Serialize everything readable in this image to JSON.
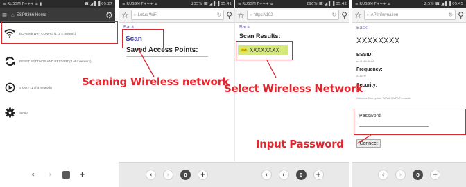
{
  "panel1": {
    "status_left": "≡ RUSSM F+++ ☕ ▮",
    "status_right": "☎ ◢ ▌▐ 05:27",
    "url_title": "ESP8266 Home",
    "menu_items": [
      {
        "icon": "wifi-icon",
        "text": "ECP8266 WIFI CONFIG (1 of 4 network)"
      },
      {
        "icon": "refresh-icon",
        "text": "RESET SETTINGS AND RESTART (3 of 4 network)"
      },
      {
        "icon": "play-icon",
        "text": "START (1 of 4 network)"
      },
      {
        "icon": "settings-icon",
        "text": "Setup"
      }
    ]
  },
  "panel2": {
    "status_left": "≡ RUSSM F+++ ☕",
    "status_right": "235% ☎ ◢ ▌▐ 05:41",
    "url": "Lotus WiFi",
    "back": "Back",
    "scan": "Scan",
    "saved_title": "Saved Access Points:"
  },
  "panel3": {
    "status_left": "≡ RUSSM F+++ ☕",
    "status_right": "296% ☎ ◢ ▌▐ 05:42",
    "url": "https://192",
    "back": "Back",
    "results_title": "Scan Results:",
    "network_signal": "-66dB",
    "network_ssid": "XXXXXXXX"
  },
  "panel4": {
    "status_left": "≡ RUSSM F+++ ☕",
    "status_right": "2.5% ☎ ◢ ▌▐ 05:45",
    "url": "AP Information",
    "back": "Back",
    "ssid": "XXXXXXXX",
    "bssid_label": "BSSID:",
    "bssid_value": "e4:f1:4d:d0:68",
    "frequency_label": "Frequency:",
    "frequency_value": "2412Hz",
    "security_label": "Security:",
    "security_value": "Wireless Encryption: WPA2 / WPA Personal",
    "password_label": "Password:",
    "password_value": "",
    "connect_label": "Connect"
  },
  "nav": {
    "back": "‹",
    "forward": "›",
    "tabs": "0",
    "new_tab": "+"
  },
  "annotations": {
    "scanning": "Scaning Wireless network",
    "select": "Select Wireless Network",
    "password": "Input Password"
  },
  "colors": {
    "annotation_red": "#e3262e",
    "network_highlight": "#d5e87c"
  }
}
